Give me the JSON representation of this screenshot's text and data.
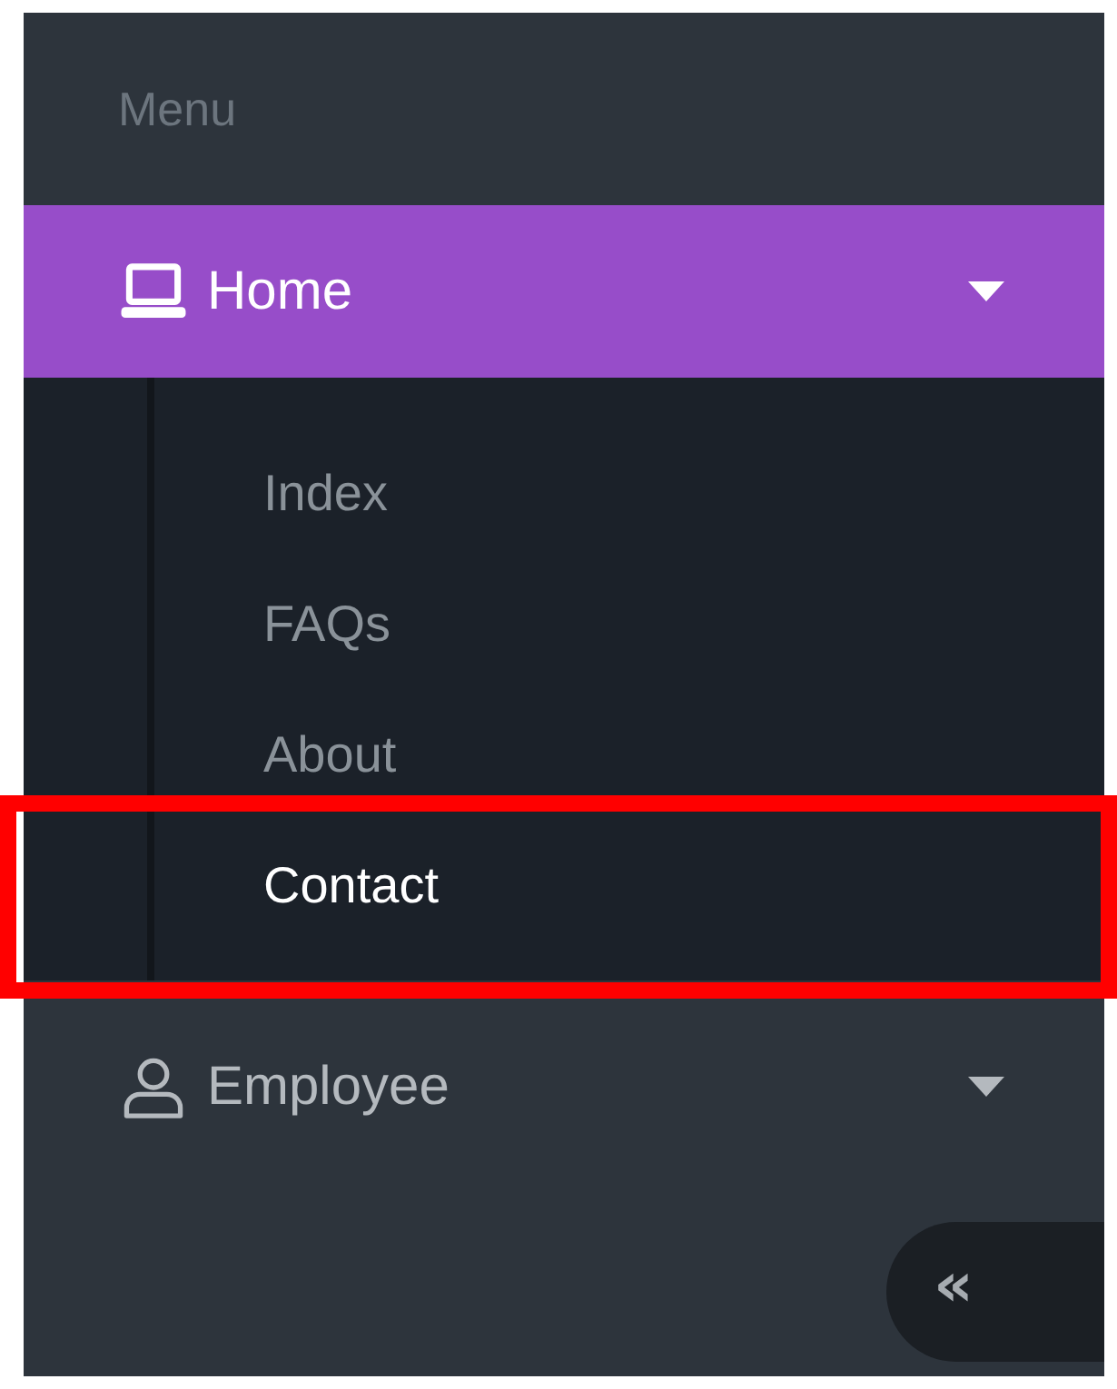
{
  "sidebar": {
    "heading": "Menu",
    "items": [
      {
        "label": "Home",
        "selected": true,
        "expanded": true,
        "children": [
          {
            "label": "Index",
            "selected": false,
            "highlighted": false
          },
          {
            "label": "FAQs",
            "selected": false,
            "highlighted": false
          },
          {
            "label": "About",
            "selected": false,
            "highlighted": false
          },
          {
            "label": "Contact",
            "selected": true,
            "highlighted": true
          }
        ]
      },
      {
        "label": "Employee",
        "selected": false,
        "expanded": false
      }
    ],
    "collapse_button": {
      "label": "«"
    }
  }
}
